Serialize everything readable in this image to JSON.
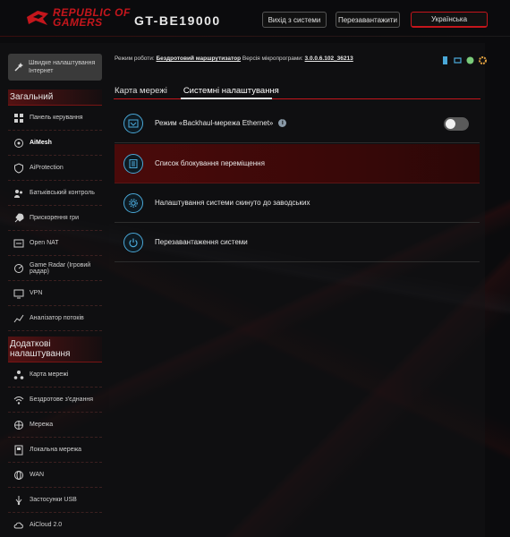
{
  "header": {
    "brand_line1": "REPUBLIC OF",
    "brand_line2": "GAMERS",
    "model": "GT-BE19000",
    "logout_label": "Вихід з системи",
    "reboot_label": "Перезавантажити",
    "language_label": "Українська"
  },
  "sidebar": {
    "quick_setup_label": "Швидке налаштування Інтернет",
    "general_title": "Загальний",
    "general_items": [
      {
        "label": "Панель керування",
        "icon": "dashboard-icon"
      },
      {
        "label": "AiMesh",
        "icon": "aimesh-icon",
        "active": true
      },
      {
        "label": "AiProtection",
        "icon": "shield-icon"
      },
      {
        "label": "Батьківський контроль",
        "icon": "parental-control-icon"
      },
      {
        "label": "Прискорення гри",
        "icon": "rocket-icon"
      },
      {
        "label": "Open NAT",
        "icon": "open-nat-icon"
      },
      {
        "label": "Game Radar (Ігровий радар)",
        "icon": "game-radar-icon"
      },
      {
        "label": "VPN",
        "icon": "vpn-icon"
      },
      {
        "label": "Аналізатор потоків",
        "icon": "traffic-analyzer-icon"
      }
    ],
    "advanced_title": "Додаткові налаштування",
    "advanced_items": [
      {
        "label": "Карта мережі",
        "icon": "network-map-icon"
      },
      {
        "label": "Бездротове з'єднання",
        "icon": "wireless-icon"
      },
      {
        "label": "Мережа",
        "icon": "network-icon"
      },
      {
        "label": "Локальна мережа",
        "icon": "lan-icon"
      },
      {
        "label": "WAN",
        "icon": "wan-icon"
      },
      {
        "label": "Застосунки USB",
        "icon": "usb-icon"
      },
      {
        "label": "AiCloud 2.0",
        "icon": "aicloud-icon"
      }
    ]
  },
  "status": {
    "mode_label": "Режим роботи:",
    "mode_value": "Бездротовий маршрутизатор",
    "firmware_label": "Версія мікропрограми:",
    "firmware_value": "3.0.0.6.102_36213"
  },
  "tabs": [
    {
      "label": "Карта мережі",
      "selected": false
    },
    {
      "label": "Системні налаштування",
      "selected": true
    }
  ],
  "settings": [
    {
      "label": "Режим «Backhaul-мережа Ethernet»",
      "icon": "ethernet-backhaul-icon",
      "toggle": false
    },
    {
      "label": "Список блокування переміщення",
      "icon": "roaming-block-list-icon"
    },
    {
      "label": "Налаштування системи скинуто до заводських",
      "icon": "factory-reset-icon"
    },
    {
      "label": "Перезавантаження системи",
      "icon": "power-icon"
    }
  ],
  "colors": {
    "accent_red": "#c4161c",
    "icon_blue": "#4aa8d8",
    "highlight_row": "#4a0a0a"
  }
}
